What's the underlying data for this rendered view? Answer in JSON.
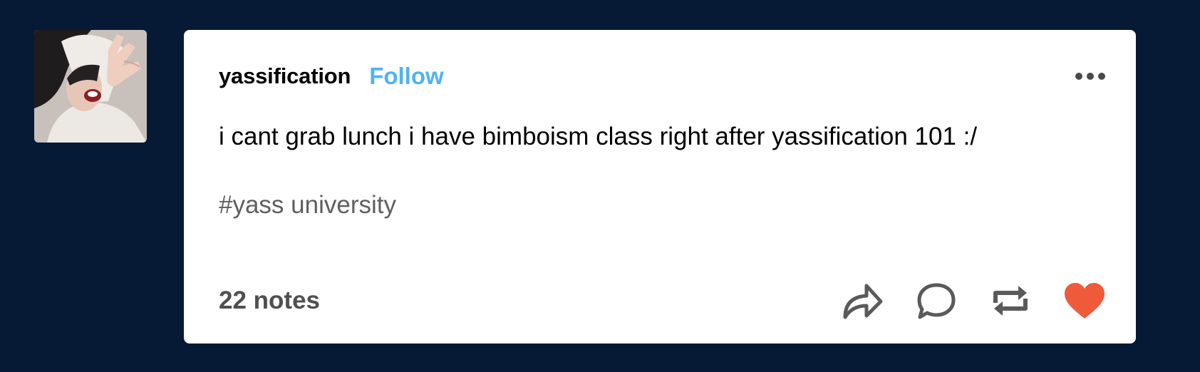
{
  "post": {
    "blog_name": "yassification",
    "follow_label": "Follow",
    "body": "i cant grab lunch i have bimboism class right after yassification 101 :/",
    "tag": "#yass university",
    "notes": "22 notes"
  },
  "icons": {
    "more": "more-options-icon",
    "share": "share-icon",
    "reply": "reply-icon",
    "reblog": "reblog-icon",
    "like": "like-icon"
  },
  "colors": {
    "page_background": "#061a35",
    "card_background": "#ffffff",
    "follow": "#4eb3f1",
    "icon_gray": "#5a5a5a",
    "like": "#ef5a3a"
  }
}
